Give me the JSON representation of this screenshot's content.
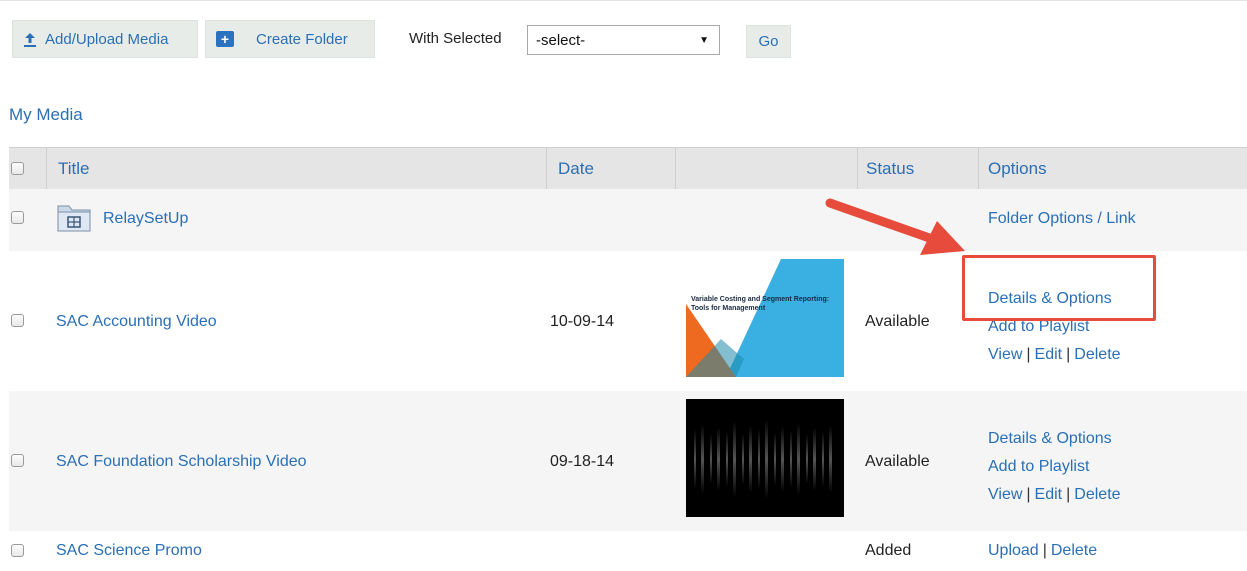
{
  "toolbar": {
    "upload_label": "Add/Upload Media",
    "create_folder_label": "Create Folder",
    "with_selected_label": "With Selected",
    "select_value": "-select-",
    "go_label": "Go"
  },
  "section_title": "My Media",
  "table": {
    "headers": {
      "title": "Title",
      "date": "Date",
      "status": "Status",
      "options": "Options"
    },
    "rows": [
      {
        "title": "RelaySetUp",
        "date": "",
        "status": "",
        "options": [
          "Folder Options / Link"
        ]
      },
      {
        "title": "SAC Accounting Video",
        "date": "10-09-14",
        "status": "Available",
        "thumbnail_title": "Variable Costing and Segment Reporting: Tools for Management",
        "options": [
          "Details & Options",
          "Add to Playlist",
          "View",
          "Edit",
          "Delete"
        ]
      },
      {
        "title": "SAC Foundation Scholarship Video",
        "date": "09-18-14",
        "status": "Available",
        "options": [
          "Details & Options",
          "Add to Playlist",
          "View",
          "Edit",
          "Delete"
        ]
      },
      {
        "title": "SAC Science Promo",
        "date": "",
        "status": "Added",
        "options": [
          "Upload",
          "Delete"
        ]
      }
    ]
  },
  "annotation": {
    "color": "#e64b3c"
  },
  "colors": {
    "link": "#2a6fb5",
    "header_bg": "#e5e5e5",
    "row_alt": "#f5f5f5"
  }
}
